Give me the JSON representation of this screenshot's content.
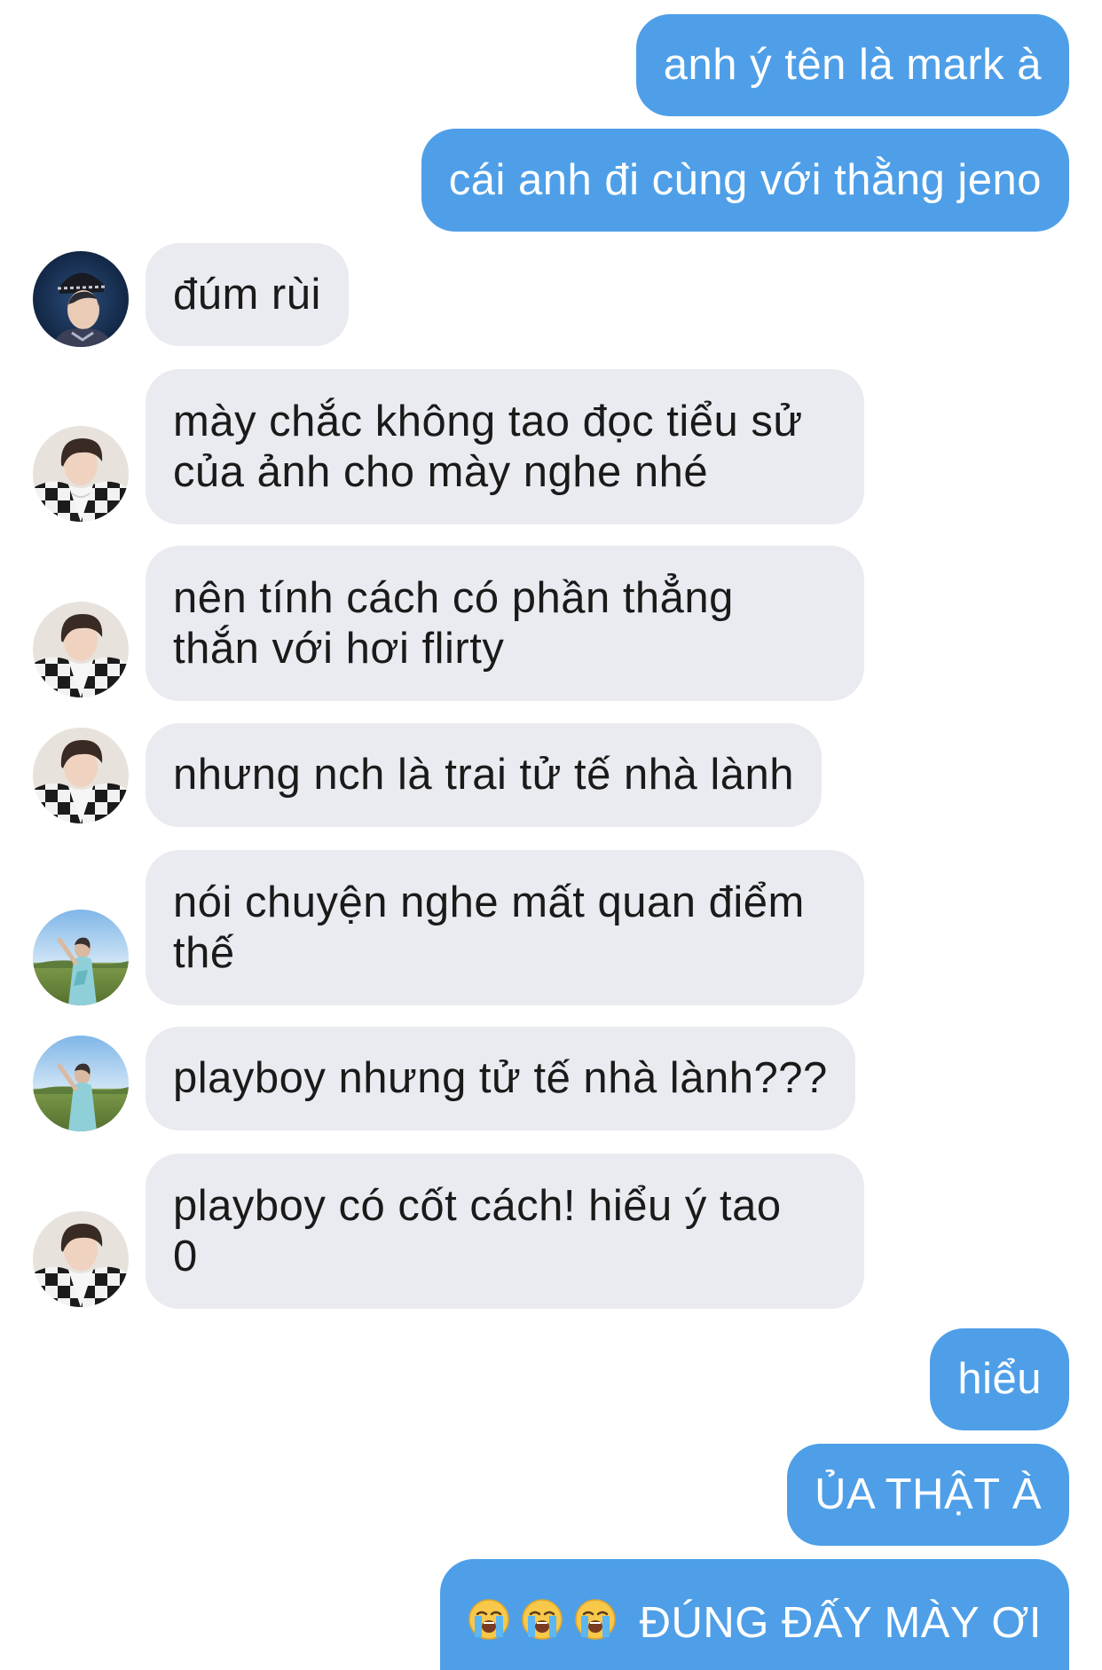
{
  "messages": [
    {
      "side": "sent",
      "text": "anh ý tên là mark à"
    },
    {
      "side": "sent",
      "text": "cái anh đi cùng với thằng jeno"
    },
    {
      "side": "recv",
      "avatar": "avatar-dark-hat",
      "text": "đúm rùi"
    },
    {
      "side": "recv",
      "avatar": "avatar-checker-jacket",
      "text": "mày chắc không tao đọc tiểu sử\ncủa ảnh cho mày nghe nhé"
    },
    {
      "side": "recv",
      "avatar": "avatar-checker-jacket",
      "text": "nên tính cách có phần thẳng\nthắn với hơi flirty"
    },
    {
      "side": "recv",
      "avatar": "avatar-checker-jacket",
      "text": "nhưng nch là trai tử tế nhà lành"
    },
    {
      "side": "recv",
      "avatar": "avatar-sky-field",
      "text": "nói chuyện nghe mất quan điểm\nthế"
    },
    {
      "side": "recv",
      "avatar": "avatar-sky-field",
      "text": "playboy nhưng tử tế nhà lành???"
    },
    {
      "side": "recv",
      "avatar": "avatar-checker-jacket",
      "text": "playboy có cốt cách! hiểu ý tao\n0"
    },
    {
      "side": "sent",
      "text": "hiểu"
    },
    {
      "side": "sent",
      "text": "ỦA THẬT À"
    },
    {
      "side": "sent",
      "emojis": [
        "loudly-crying-face-icon",
        "loudly-crying-face-icon",
        "loudly-crying-face-icon"
      ],
      "text": "ĐÚNG ĐẤY MÀY ƠI"
    }
  ],
  "colors": {
    "sent_bubble": "#4e9fe8",
    "received_bubble": "#e9ebf0",
    "sent_text": "#ffffff",
    "received_text": "#1a1a1a"
  }
}
